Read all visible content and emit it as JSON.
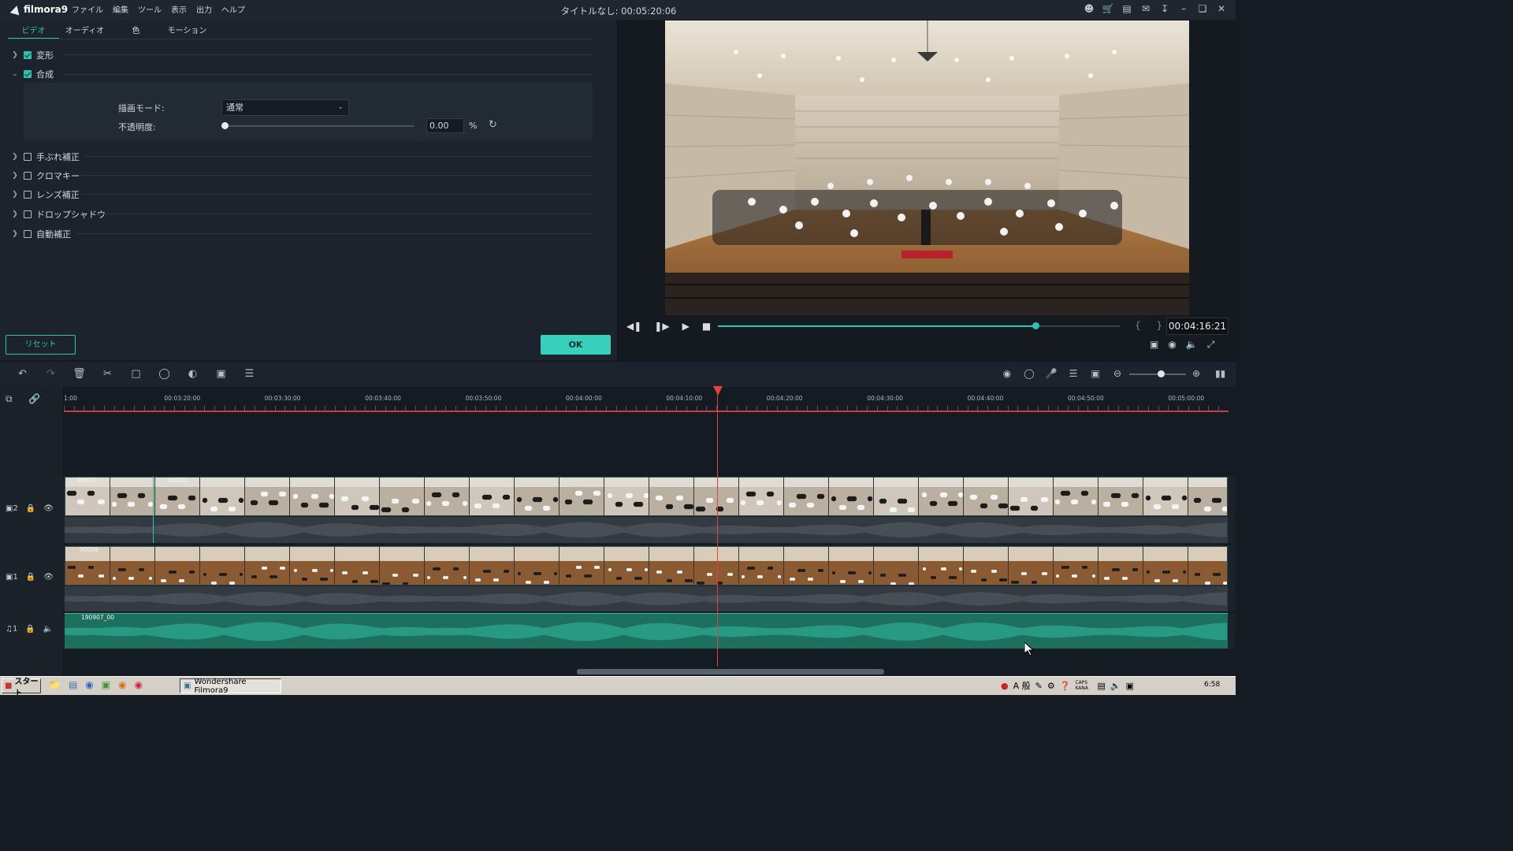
{
  "titlebar": {
    "app_name": "filmora9",
    "menu": [
      "ファイル",
      "編集",
      "ツール",
      "表示",
      "出力",
      "ヘルプ"
    ],
    "window_title": "タイトルなし: 00:05:20:06"
  },
  "properties": {
    "tabs": [
      "ビデオ",
      "オーディオ",
      "色",
      "モーション"
    ],
    "active_tab": "ビデオ",
    "sections": [
      {
        "label": "変形",
        "checked": true,
        "expanded": false
      },
      {
        "label": "合成",
        "checked": true,
        "expanded": true
      },
      {
        "label": "手ぶれ補正",
        "checked": false,
        "expanded": false
      },
      {
        "label": "クロマキー",
        "checked": false,
        "expanded": false
      },
      {
        "label": "レンズ補正",
        "checked": false,
        "expanded": false
      },
      {
        "label": "ドロップシャドウ",
        "checked": false,
        "expanded": false
      },
      {
        "label": "自動補正",
        "checked": false,
        "expanded": false
      }
    ],
    "blend_mode_label": "描画モード:",
    "blend_mode_value": "通常",
    "opacity_label": "不透明度:",
    "opacity_value": "0.00",
    "opacity_unit": "%",
    "reset_button": "リセット",
    "ok_button": "OK"
  },
  "preview": {
    "timecode": "00:04:16:21",
    "progress_fraction": 0.79,
    "marks": "{ }"
  },
  "timeline": {
    "ruler_labels": [
      "1:00",
      "00:03:20:00",
      "00:03:30:00",
      "00:03:40:00",
      "00:03:50:00",
      "00:04:00:00",
      "00:04:10:00",
      "00:04:20:00",
      "00:04:30:00",
      "00:04:40:00",
      "00:04:50:00",
      "00:05:00:00"
    ],
    "tracks": [
      {
        "id": "video-2",
        "number": "2",
        "clip_labels": [
          "00027",
          "00027"
        ]
      },
      {
        "id": "video-1",
        "number": "1",
        "clip_labels": [
          "00009"
        ]
      },
      {
        "id": "audio-1",
        "number": "1",
        "clip_labels": [
          "190907_00"
        ]
      }
    ]
  },
  "taskbar": {
    "start_label": "スタート",
    "active_task": "Wondershare Filmora9",
    "clock": "6:58",
    "ime": "A 般",
    "caps": "CAPS KANA"
  },
  "colors": {
    "accent": "#2fc1b1",
    "playhead": "#e3413f",
    "panel": "#1c232c",
    "audio_clip": "#1d6f5e"
  }
}
